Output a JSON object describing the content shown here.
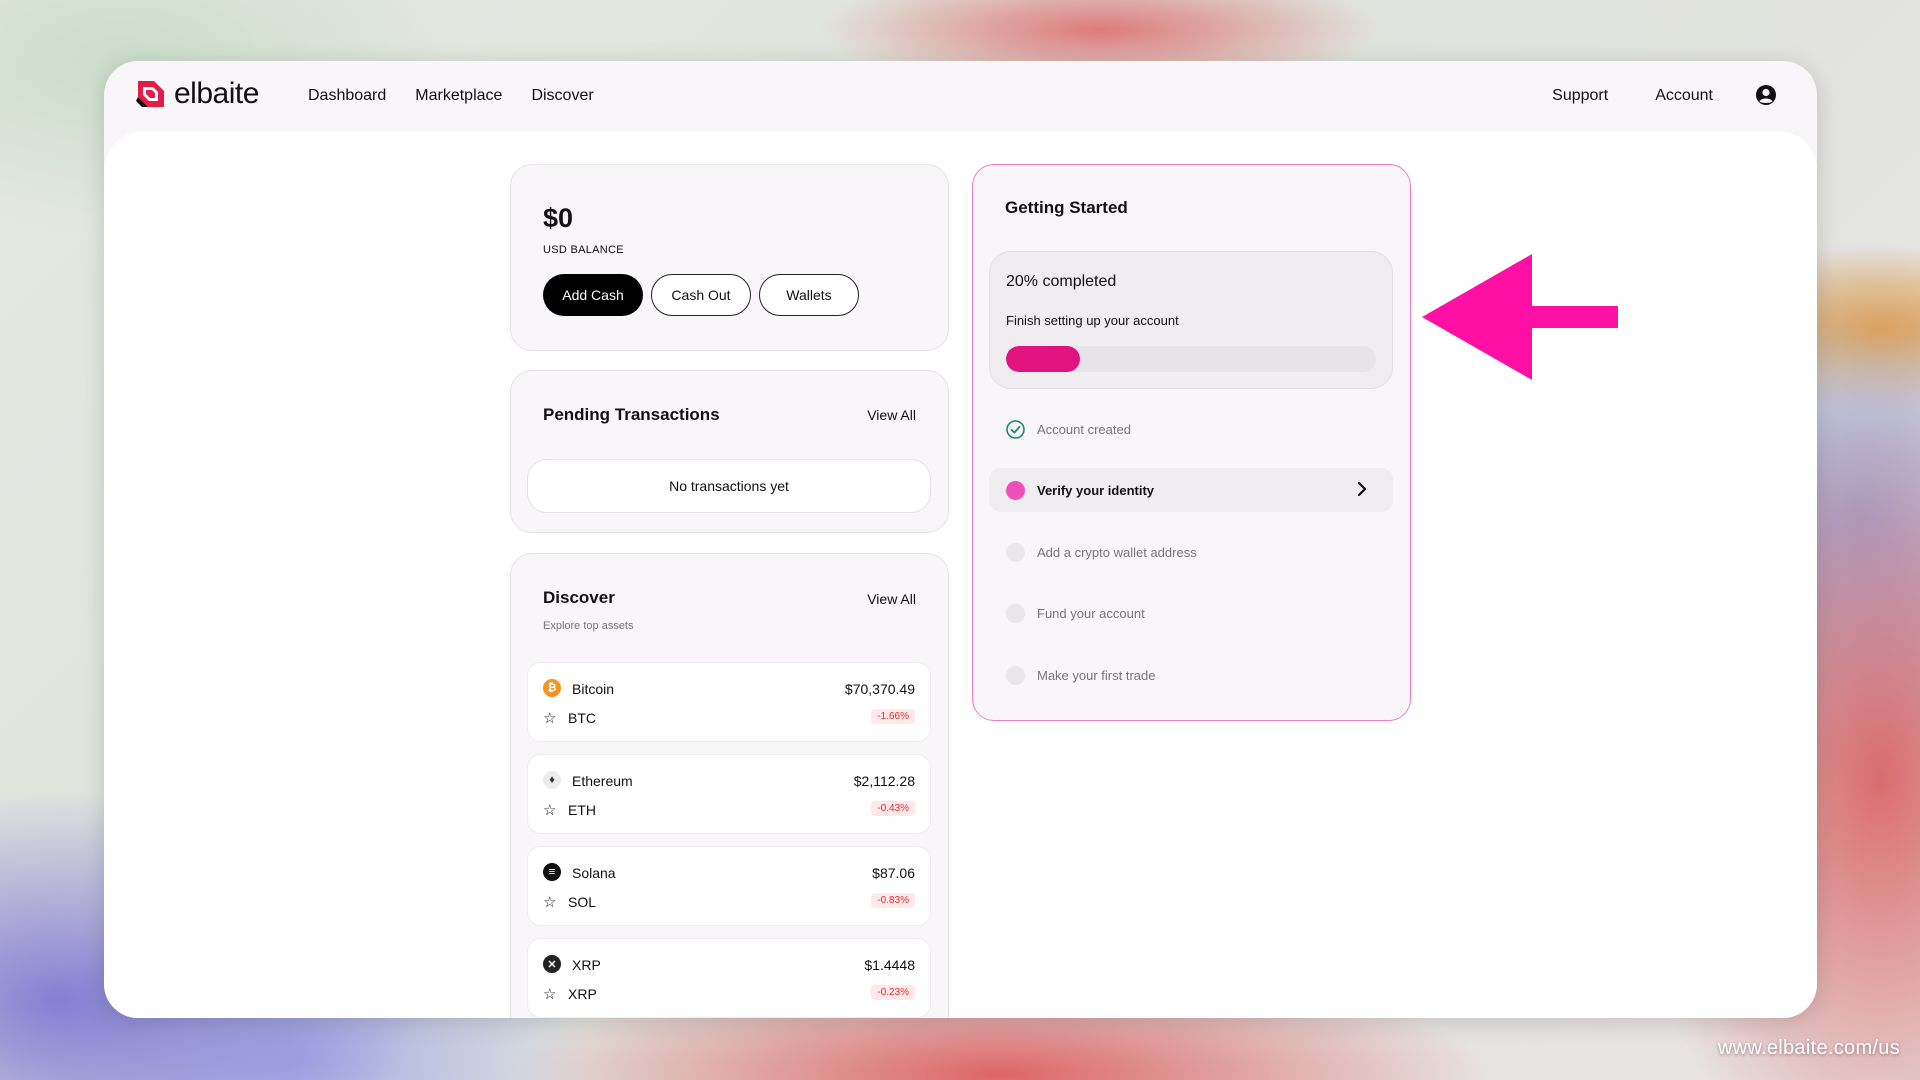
{
  "brand": {
    "name": "elbaite"
  },
  "nav": {
    "dashboard": "Dashboard",
    "marketplace": "Marketplace",
    "discover": "Discover"
  },
  "right_nav": {
    "support": "Support",
    "account": "Account"
  },
  "balance": {
    "amount": "$0",
    "label": "USD BALANCE",
    "add_cash": "Add Cash",
    "cash_out": "Cash Out",
    "wallets": "Wallets"
  },
  "pending": {
    "title": "Pending Transactions",
    "view_all": "View All",
    "empty": "No transactions yet"
  },
  "discover": {
    "title": "Discover",
    "view_all": "View All",
    "subtitle": "Explore top assets",
    "assets": [
      {
        "name": "Bitcoin",
        "symbol": "BTC",
        "price": "$70,370.49",
        "change": "-1.66%",
        "icon": "bitcoin-icon",
        "color": "#f7931a"
      },
      {
        "name": "Ethereum",
        "symbol": "ETH",
        "price": "$2,112.28",
        "change": "-0.43%",
        "icon": "ethereum-icon",
        "color": "#555555"
      },
      {
        "name": "Solana",
        "symbol": "SOL",
        "price": "$87.06",
        "change": "-0.83%",
        "icon": "solana-icon",
        "color": "#111111"
      },
      {
        "name": "XRP",
        "symbol": "XRP",
        "price": "$1.4448",
        "change": "-0.23%",
        "icon": "xrp-icon",
        "color": "#222222"
      }
    ]
  },
  "getting_started": {
    "title": "Getting Started",
    "progress_label": "20% completed",
    "progress_sub": "Finish setting up your account",
    "progress": 0.2,
    "steps": [
      {
        "label": "Account created",
        "state": "done"
      },
      {
        "label": "Verify your identity",
        "state": "active"
      },
      {
        "label": "Add a crypto wallet address",
        "state": "todo"
      },
      {
        "label": "Fund your account",
        "state": "todo"
      },
      {
        "label": "Make your first trade",
        "state": "todo"
      }
    ]
  },
  "colors": {
    "accent": "#e0137f",
    "arrow": "#ff1aa8",
    "border_highlight": "#f07dc6"
  },
  "watermark": "www.elbaite.com/us"
}
